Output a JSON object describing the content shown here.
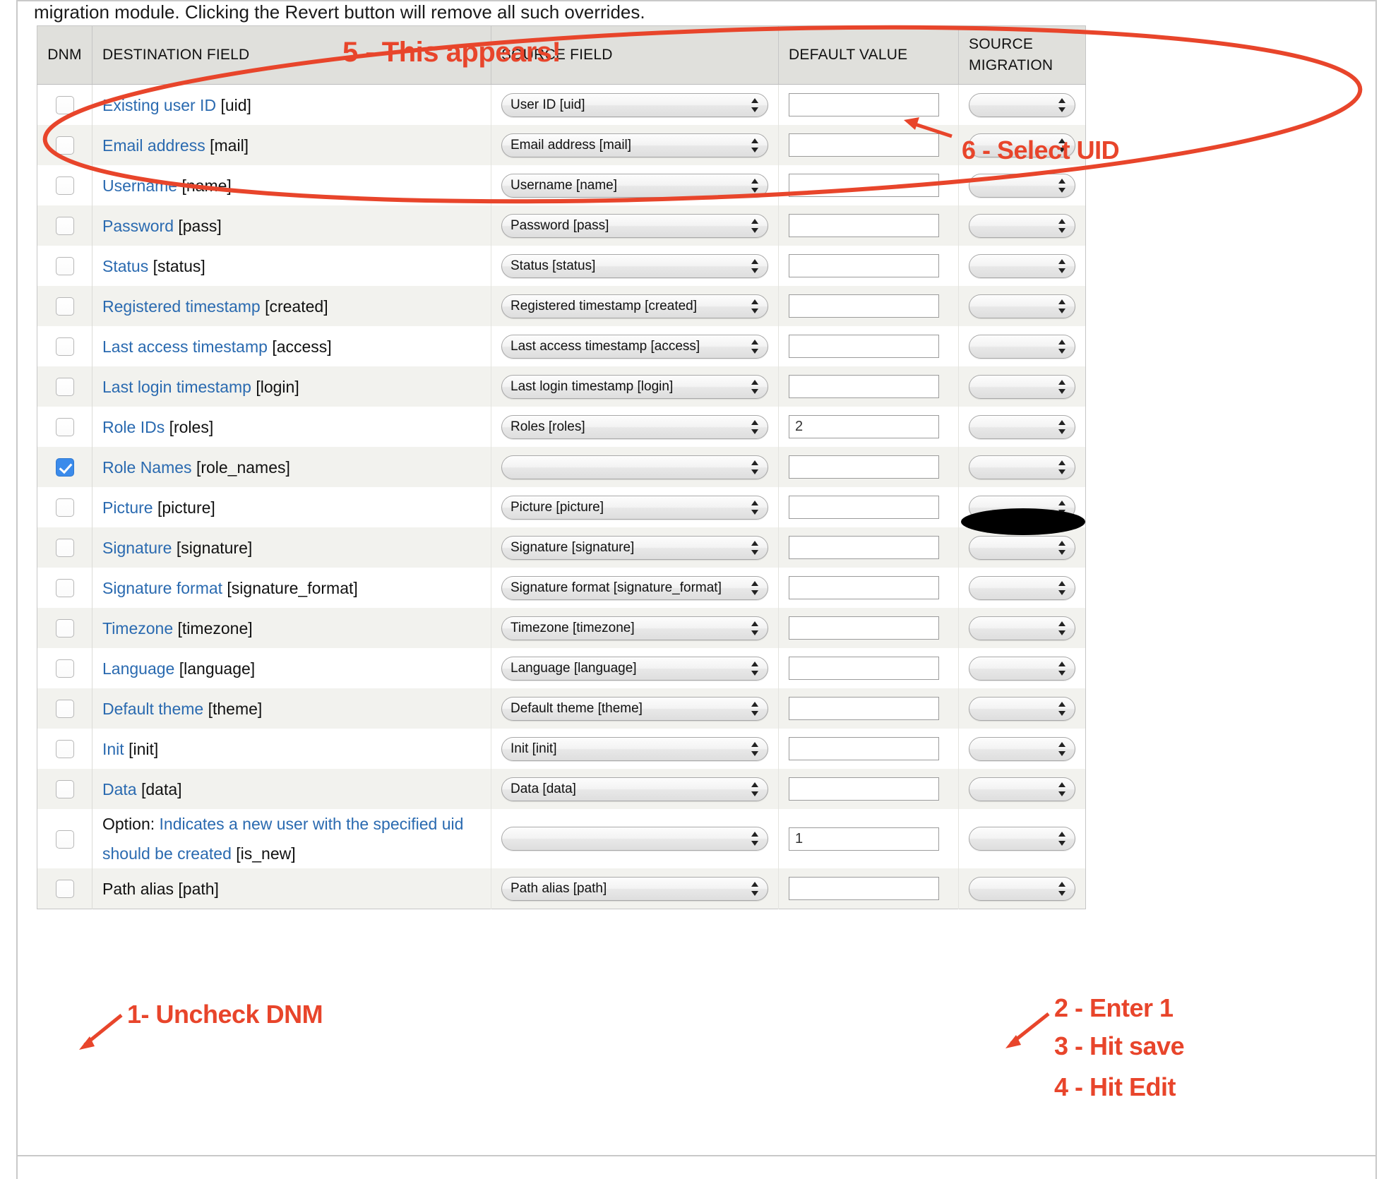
{
  "intro": {
    "text": "migration module. Clicking the Revert button will remove all such overrides."
  },
  "table": {
    "headers": {
      "dnm": "DNM",
      "destination_field": "DESTINATION FIELD",
      "source_field": "SOURCE FIELD",
      "default_value": "DEFAULT VALUE",
      "source_migration_line1": "SOURCE",
      "source_migration_line2": "MIGRATION"
    },
    "rows": [
      {
        "dnm_checked": false,
        "dest_name": "Existing user ID ",
        "dest_machine": "[uid]",
        "source_field": "User ID [uid]",
        "default_value": "",
        "source_migration": ""
      },
      {
        "dnm_checked": false,
        "dest_name": "Email address ",
        "dest_machine": "[mail]",
        "source_field": "Email address [mail]",
        "default_value": "",
        "source_migration": ""
      },
      {
        "dnm_checked": false,
        "dest_name": "Username ",
        "dest_machine": "[name]",
        "source_field": "Username [name]",
        "default_value": "",
        "source_migration": ""
      },
      {
        "dnm_checked": false,
        "dest_name": "Password ",
        "dest_machine": "[pass]",
        "source_field": "Password [pass]",
        "default_value": "",
        "source_migration": ""
      },
      {
        "dnm_checked": false,
        "dest_name": "Status ",
        "dest_machine": "[status]",
        "source_field": "Status [status]",
        "default_value": "",
        "source_migration": ""
      },
      {
        "dnm_checked": false,
        "dest_name": "Registered timestamp ",
        "dest_machine": "[created]",
        "source_field": "Registered timestamp [created]",
        "default_value": "",
        "source_migration": ""
      },
      {
        "dnm_checked": false,
        "dest_name": "Last access timestamp ",
        "dest_machine": "[access]",
        "source_field": "Last access timestamp [access]",
        "default_value": "",
        "source_migration": ""
      },
      {
        "dnm_checked": false,
        "dest_name": "Last login timestamp ",
        "dest_machine": "[login]",
        "source_field": "Last login timestamp [login]",
        "default_value": "",
        "source_migration": ""
      },
      {
        "dnm_checked": false,
        "dest_name": "Role IDs ",
        "dest_machine": "[roles]",
        "source_field": "Roles [roles]",
        "default_value": "2",
        "source_migration": ""
      },
      {
        "dnm_checked": true,
        "dest_name": "Role Names ",
        "dest_machine": "[role_names]",
        "source_field": "",
        "default_value": "",
        "source_migration": ""
      },
      {
        "dnm_checked": false,
        "dest_name": "Picture ",
        "dest_machine": "[picture]",
        "source_field": "Picture [picture]",
        "default_value": "",
        "source_migration": ""
      },
      {
        "dnm_checked": false,
        "dest_name": "Signature ",
        "dest_machine": "[signature]",
        "source_field": "Signature [signature]",
        "default_value": "",
        "source_migration": ""
      },
      {
        "dnm_checked": false,
        "dest_name": "Signature format ",
        "dest_machine": "[signature_format]",
        "source_field": "Signature format [signature_format]",
        "default_value": "",
        "source_migration": ""
      },
      {
        "dnm_checked": false,
        "dest_name": "Timezone ",
        "dest_machine": "[timezone]",
        "source_field": "Timezone [timezone]",
        "default_value": "",
        "source_migration": ""
      },
      {
        "dnm_checked": false,
        "dest_name": "Language ",
        "dest_machine": "[language]",
        "source_field": "Language [language]",
        "default_value": "",
        "source_migration": ""
      },
      {
        "dnm_checked": false,
        "dest_name": "Default theme ",
        "dest_machine": "[theme]",
        "source_field": "Default theme [theme]",
        "default_value": "",
        "source_migration": ""
      },
      {
        "dnm_checked": false,
        "dest_name": "Init ",
        "dest_machine": "[init]",
        "source_field": "Init [init]",
        "default_value": "",
        "source_migration": ""
      },
      {
        "dnm_checked": false,
        "dest_name": "Data ",
        "dest_machine": "[data]",
        "source_field": "Data [data]",
        "default_value": "",
        "source_migration": ""
      },
      {
        "dnm_checked": false,
        "dest_prefix": "Option: ",
        "dest_name": "Indicates a new user with the specified uid should be created ",
        "dest_machine": "[is_new]",
        "source_field": "",
        "default_value": "1",
        "source_migration": ""
      },
      {
        "dnm_checked": false,
        "dest_name_plain": "Path alias ",
        "dest_machine": "[path]",
        "source_field": "Path alias [path]",
        "default_value": "",
        "source_migration": ""
      }
    ]
  },
  "annotations": {
    "step5": "5 - This appears!",
    "step6": "6 - Select UID",
    "step1": "1- Uncheck DNM",
    "step2": "2 - Enter 1",
    "step3": "3 - Hit save",
    "step4": "4 - Hit Edit",
    "color": "#e8452b"
  }
}
